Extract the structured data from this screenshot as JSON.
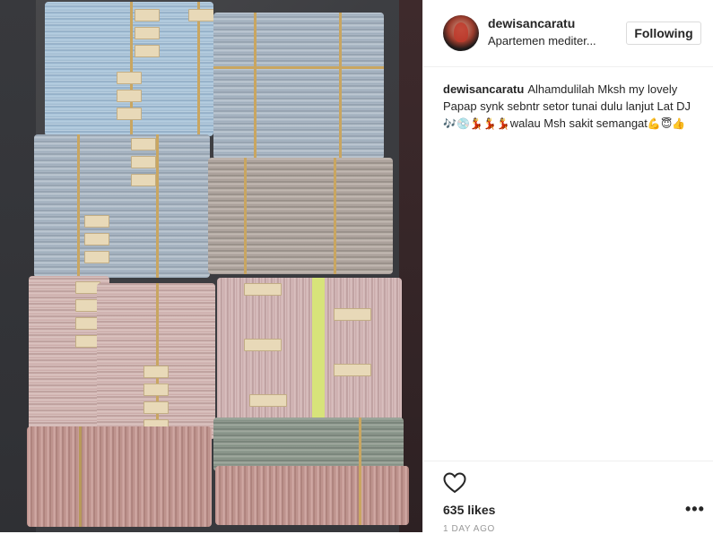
{
  "post": {
    "username": "dewisancaratu",
    "location": "Apartemen mediter...",
    "follow_label": "Following",
    "caption_user": "dewisancaratu",
    "caption_text": "Alhamdulilah Mksh my lovely Papap synk sebntr setor tunai dulu lanjut Lat DJ",
    "caption_tail": "walau Msh sakit semangat",
    "emojis_a": "🎶💿💃💃💃",
    "emojis_b": "💪😇👍",
    "likes": "635 likes",
    "timestamp": "1 DAY AGO",
    "more_label": "•••"
  },
  "photo": {
    "alt": "Stacks of banknotes"
  },
  "colors": {
    "text": "#262626",
    "muted": "#999999",
    "border": "#efefef"
  },
  "icons": {
    "like": "heart-outline-icon",
    "more": "more-options-icon"
  }
}
